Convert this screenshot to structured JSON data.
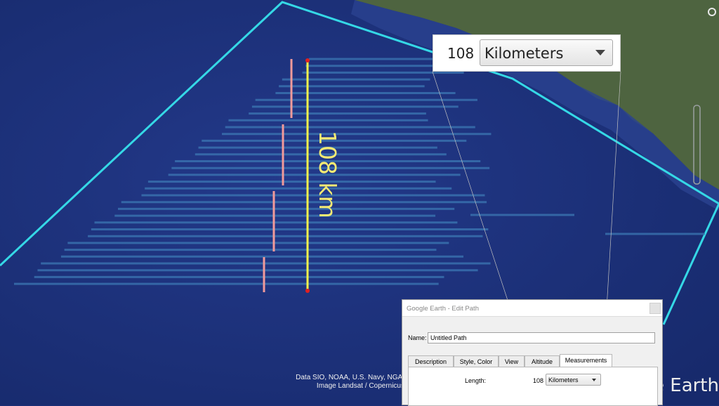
{
  "map": {
    "path_label": "108 km",
    "credits_line1": "Data SIO, NOAA, U.S. Navy, NGA,",
    "credits_line2": "Image Landsat / Copernicus",
    "logo_text": "e Earth",
    "colors": {
      "ocean": "#1c2f78",
      "boundary": "#35d8e6",
      "path": "#f7f24a",
      "markers": "#f29a9a",
      "swath": "#3c78b4",
      "land": "#5a6e3c"
    }
  },
  "zoom_callout": {
    "value": "108",
    "unit": "Kilometers"
  },
  "dialog": {
    "title": "Google Earth - Edit Path",
    "name_label": "Name:",
    "name_value": "Untitled Path",
    "tabs": [
      "Description",
      "Style, Color",
      "View",
      "Altitude",
      "Measurements"
    ],
    "active_tab": "Measurements",
    "length_label": "Length:",
    "length_value": "108",
    "unit": "Kilometers"
  }
}
